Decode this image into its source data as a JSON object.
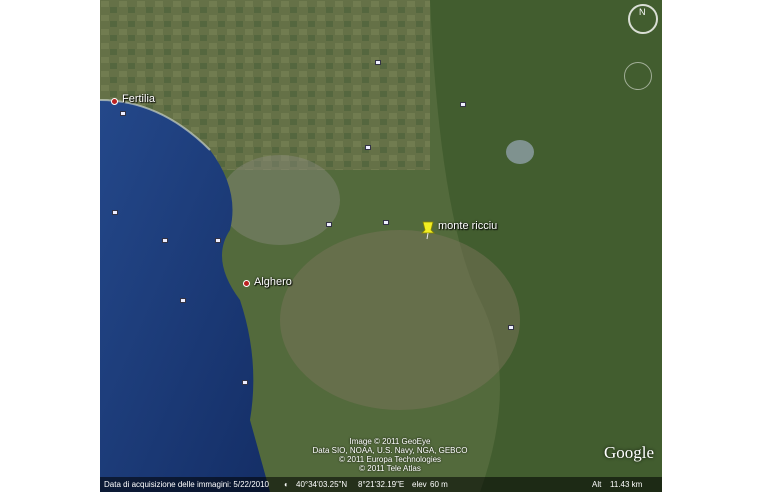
{
  "places": [
    {
      "name": "Fertilia"
    },
    {
      "name": "Alghero"
    }
  ],
  "placemark": {
    "label": "monte ricciu",
    "color": "#f2ee22"
  },
  "copyright": [
    "Image © 2011 GeoEye",
    "Data SIO, NOAA, U.S. Navy, NGA, GEBCO",
    "© 2011 Europa Technologies",
    "© 2011 Tele Atlas"
  ],
  "status": {
    "imagery_date": "Data di acquisizione delle immagini: 5/22/2010",
    "coords": "40°34'03.25\"N",
    "lon": "8°21'32.19\"E",
    "elev": "elev",
    "elev_value": "60 m",
    "alt_label": "Alt",
    "alt_value": "11.43 km"
  },
  "logo": "Google",
  "compass": "N",
  "colors": {
    "sea": "#1a3c7a",
    "land": "#5d6d43",
    "placemark": "#f2ee22"
  }
}
